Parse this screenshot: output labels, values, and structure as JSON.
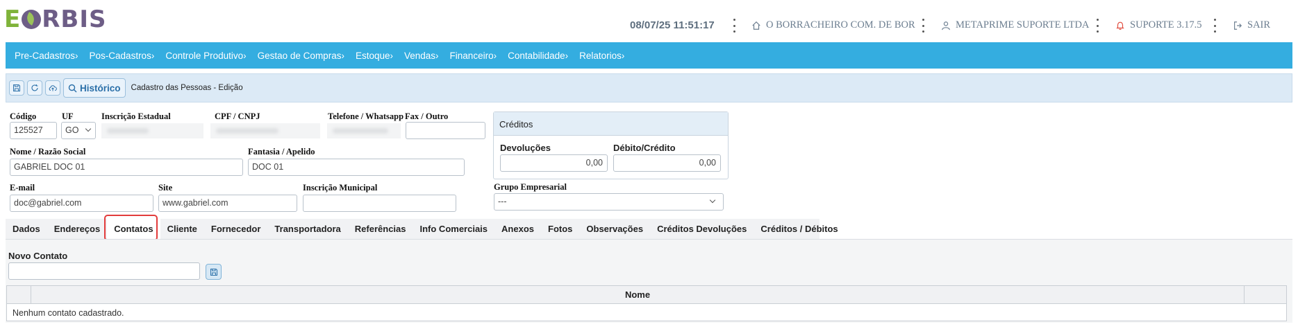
{
  "brand": {
    "logo_left": "E",
    "logo_right": "RBIS"
  },
  "header": {
    "datetime": "08/07/25 11:51:17",
    "company": "O BORRACHEIRO COM. DE BOR",
    "user": "METAPRIME SUPORTE LTDA",
    "version": "SUPORTE 3.17.5",
    "logout": "SAIR"
  },
  "nav": {
    "items": [
      "Pre-Cadastros›",
      "Pos-Cadastros›",
      "Controle Produtivo›",
      "Gestao de Compras›",
      "Estoque›",
      "Vendas›",
      "Financeiro›",
      "Contabilidade›",
      "Relatorios›"
    ]
  },
  "toolbar": {
    "history_label": "Histórico",
    "title": "Cadastro das Pessoas - Edição"
  },
  "form": {
    "codigo_label": "Código",
    "codigo_value": "125527",
    "uf_label": "UF",
    "uf_value": "GO",
    "ie_label": "Inscrição Estadual",
    "cpf_label": "CPF / CNPJ",
    "telefone_label": "Telefone / Whatsapp",
    "fax_label": "Fax / Outro",
    "fax_value": "",
    "nome_label": "Nome / Razão Social",
    "nome_value": "GABRIEL DOC 01",
    "fantasia_label": "Fantasia / Apelido",
    "fantasia_value": "DOC 01",
    "email_label": "E-mail",
    "email_value": "doc@gabriel.com",
    "site_label": "Site",
    "site_value": "www.gabriel.com",
    "im_label": "Inscrição Municipal",
    "im_value": "",
    "grupo_label": "Grupo Empresarial",
    "grupo_value": "---"
  },
  "credits": {
    "title": "Créditos",
    "devolucoes_label": "Devoluções",
    "devolucoes_value": "0,00",
    "debito_label": "Débito/Crédito",
    "debito_value": "0,00"
  },
  "tabs": [
    "Dados",
    "Endereços",
    "Contatos",
    "Cliente",
    "Fornecedor",
    "Transportadora",
    "Referências",
    "Info Comerciais",
    "Anexos",
    "Fotos",
    "Observações",
    "Créditos Devoluções",
    "Créditos / Débitos"
  ],
  "contacts": {
    "new_label": "Novo Contato",
    "new_value": "",
    "column_name": "Nome",
    "empty_message": "Nenhum contato cadastrado."
  },
  "colors": {
    "nav_bg": "#34ade0",
    "toolbar_bg": "#dceaf6",
    "highlight": "#e23b3b",
    "logo_green": "#7fb33a",
    "logo_purple": "#6d5d86"
  }
}
